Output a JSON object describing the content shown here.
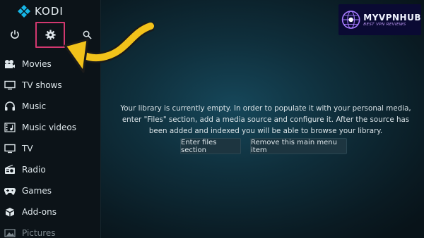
{
  "brand": {
    "name": "KODI"
  },
  "top_buttons": [
    {
      "icon": "power-icon"
    },
    {
      "icon": "gear-icon"
    },
    {
      "icon": "search-icon"
    }
  ],
  "nav": {
    "items": [
      {
        "label": "Movies",
        "icon": "film-icon"
      },
      {
        "label": "TV shows",
        "icon": "tv-icon"
      },
      {
        "label": "Music",
        "icon": "headphones-icon"
      },
      {
        "label": "Music videos",
        "icon": "music-video-icon"
      },
      {
        "label": "TV",
        "icon": "tv-icon"
      },
      {
        "label": "Radio",
        "icon": "radio-icon"
      },
      {
        "label": "Games",
        "icon": "gamepad-icon"
      },
      {
        "label": "Add-ons",
        "icon": "addons-icon"
      },
      {
        "label": "Pictures",
        "icon": "pictures-icon"
      }
    ]
  },
  "main": {
    "message": "Your library is currently empty. In order to populate it with your personal media, enter \"Files\" section, add a media source and configure it. After the source has been added and indexed you will be able to browse your library.",
    "button_enter_files": "Enter files section",
    "button_remove_item": "Remove this main menu item"
  },
  "watermark": {
    "title": "MYVPNHUB",
    "subtitle": "BEST VPN REVIEWS"
  },
  "colors": {
    "highlight": "#d2386f",
    "arrow": "#f2c21a",
    "accent": "#17b6e6"
  }
}
